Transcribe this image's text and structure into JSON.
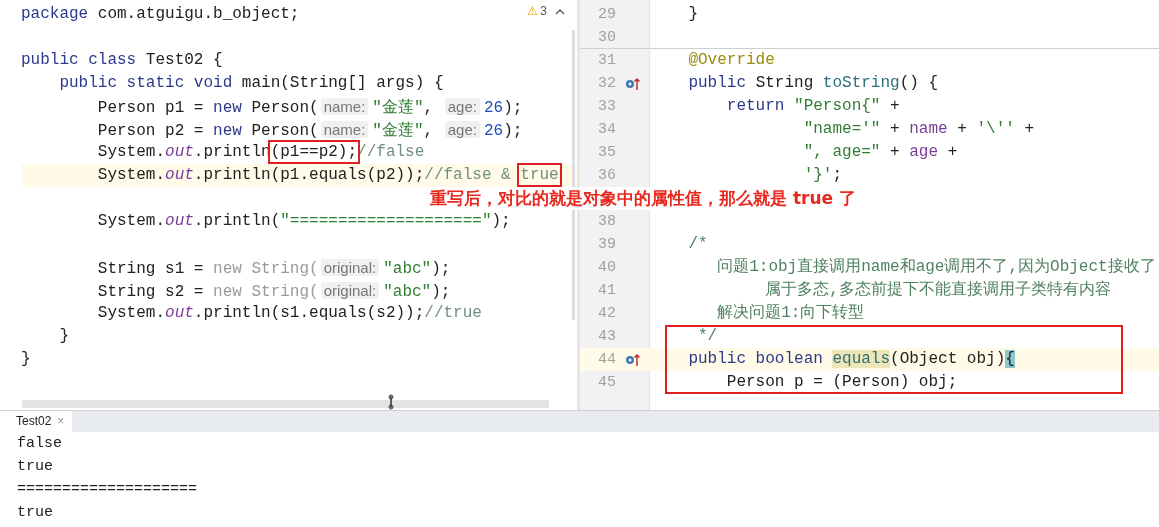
{
  "left_editor": {
    "warnings": {
      "icon_text": "⚠",
      "count": "3"
    },
    "lines": [
      {
        "tokens": [
          {
            "text": "package ",
            "kind": "kw"
          },
          {
            "text": "com.atguigu.b_object;",
            "kind": "plain"
          }
        ]
      },
      {
        "kind": "blank"
      },
      {
        "tokens": [
          {
            "text": "public class ",
            "kind": "kw"
          },
          {
            "text": "Test02 {",
            "kind": "plain"
          }
        ]
      },
      {
        "tokens": [
          {
            "text": "    public static void ",
            "kind": "kw"
          },
          {
            "text": "main(String[] args) {",
            "kind": "plain"
          }
        ]
      },
      {
        "tokens": [
          {
            "text": "        Person p1 = ",
            "kind": "plain"
          },
          {
            "text": "new ",
            "kind": "kw"
          },
          {
            "text": "Person(",
            "kind": "plain"
          },
          {
            "text": "name:",
            "kind": "hint"
          },
          {
            "text": "\"金莲\"",
            "kind": "str"
          },
          {
            "text": ", ",
            "kind": "plain"
          },
          {
            "text": "age:",
            "kind": "hint"
          },
          {
            "text": "26",
            "kind": "num"
          },
          {
            "text": ");",
            "kind": "plain"
          }
        ]
      },
      {
        "tokens": [
          {
            "text": "        Person p2 = ",
            "kind": "plain"
          },
          {
            "text": "new ",
            "kind": "kw"
          },
          {
            "text": "Person(",
            "kind": "plain"
          },
          {
            "text": "name:",
            "kind": "hint"
          },
          {
            "text": "\"金莲\"",
            "kind": "str"
          },
          {
            "text": ", ",
            "kind": "plain"
          },
          {
            "text": "age:",
            "kind": "hint"
          },
          {
            "text": "26",
            "kind": "num"
          },
          {
            "text": ");",
            "kind": "plain"
          }
        ]
      },
      {
        "tokens": [
          {
            "text": "        System.",
            "kind": "plain"
          },
          {
            "text": "out",
            "kind": "field"
          },
          {
            "text": ".println",
            "kind": "plain"
          },
          {
            "text": "(p1==p2);",
            "kind": "plain",
            "boxed": true
          },
          {
            "text": "//false",
            "kind": "comment"
          }
        ]
      },
      {
        "highlighted": true,
        "tokens": [
          {
            "text": "        System.",
            "kind": "plain"
          },
          {
            "text": "out",
            "kind": "field"
          },
          {
            "text": ".println(p1.equals(p2));",
            "kind": "plain"
          },
          {
            "text": "//false & ",
            "kind": "comment"
          },
          {
            "text": "true",
            "kind": "comment",
            "boxed": true
          }
        ]
      },
      {
        "kind": "blank"
      },
      {
        "tokens": [
          {
            "text": "        System.",
            "kind": "plain"
          },
          {
            "text": "out",
            "kind": "field"
          },
          {
            "text": ".println(",
            "kind": "plain"
          },
          {
            "text": "\"====================\"",
            "kind": "str"
          },
          {
            "text": ");",
            "kind": "plain"
          }
        ]
      },
      {
        "kind": "blank"
      },
      {
        "tokens": [
          {
            "text": "        String s1 = ",
            "kind": "plain"
          },
          {
            "text": "new String(",
            "kind": "faint"
          },
          {
            "text": "original:",
            "kind": "hint"
          },
          {
            "text": "\"abc\"",
            "kind": "str"
          },
          {
            "text": ");",
            "kind": "plain"
          }
        ]
      },
      {
        "tokens": [
          {
            "text": "        String s2 = ",
            "kind": "plain"
          },
          {
            "text": "new String(",
            "kind": "faint"
          },
          {
            "text": "original:",
            "kind": "hint"
          },
          {
            "text": "\"abc\"",
            "kind": "str"
          },
          {
            "text": ");",
            "kind": "plain"
          }
        ]
      },
      {
        "tokens": [
          {
            "text": "        System.",
            "kind": "plain"
          },
          {
            "text": "out",
            "kind": "field"
          },
          {
            "text": ".println(s1.equals(s2));",
            "kind": "plain"
          },
          {
            "text": "//true",
            "kind": "comment"
          }
        ]
      },
      {
        "tokens": [
          {
            "text": "    }",
            "kind": "plain"
          }
        ]
      },
      {
        "tokens": [
          {
            "text": "}",
            "kind": "plain"
          }
        ]
      }
    ]
  },
  "note": "重写后，对比的就是对象中的属性值，那么就是 true 了",
  "right_editor": {
    "blocks": [
      {
        "boxed": false,
        "lines": [
          {
            "number": "29",
            "tokens": [
              {
                "text": "    }",
                "kind": "plain"
              }
            ]
          },
          {
            "number": "30",
            "separator_after": true
          },
          {
            "number": "31",
            "tokens": [
              {
                "text": "    @Override",
                "kind": "annotation"
              }
            ]
          },
          {
            "number": "32",
            "marker": {
              "kind": "override"
            },
            "tokens": [
              {
                "text": "    public ",
                "kind": "kw"
              },
              {
                "text": "String ",
                "kind": "plain"
              },
              {
                "text": "toString",
                "kind": "method"
              },
              {
                "text": "() {",
                "kind": "plain"
              }
            ]
          },
          {
            "number": "33",
            "tokens": [
              {
                "text": "        return ",
                "kind": "kw"
              },
              {
                "text": "\"Person{\"",
                "kind": "str"
              },
              {
                "text": " +",
                "kind": "plain"
              }
            ]
          },
          {
            "number": "34",
            "tokens": [
              {
                "text": "                \"name='\"",
                "kind": "str"
              },
              {
                "text": " + ",
                "kind": "plain"
              },
              {
                "text": "name",
                "kind": "field2"
              },
              {
                "text": " + ",
                "kind": "plain"
              },
              {
                "text": "'\\''",
                "kind": "str"
              },
              {
                "text": " +",
                "kind": "plain"
              }
            ]
          },
          {
            "number": "35",
            "tokens": [
              {
                "text": "                \", age=\"",
                "kind": "str"
              },
              {
                "text": " + ",
                "kind": "plain"
              },
              {
                "text": "age",
                "kind": "field2"
              },
              {
                "text": " +",
                "kind": "plain"
              }
            ]
          },
          {
            "number": "36",
            "tokens": [
              {
                "text": "                '}'",
                "kind": "str"
              },
              {
                "text": ";",
                "kind": "plain"
              }
            ]
          },
          {
            "kind": "blank"
          },
          {
            "number": "38"
          },
          {
            "number": "39",
            "tokens": [
              {
                "text": "    /*",
                "kind": "doc"
              }
            ]
          },
          {
            "number": "40",
            "tokens": [
              {
                "text": "       问题1:obj直接调用name和age调用不了,因为Object接收了",
                "kind": "doc"
              }
            ]
          },
          {
            "number": "41",
            "tokens": [
              {
                "text": "            属于多态,多态前提下不能直接调用子类特有内容",
                "kind": "doc"
              }
            ]
          },
          {
            "number": "42",
            "tokens": [
              {
                "text": "       解决问题1:向下转型",
                "kind": "doc"
              }
            ]
          }
        ]
      },
      {
        "boxed": true,
        "lines": [
          {
            "number": "43",
            "tokens": [
              {
                "text": "     */",
                "kind": "doc"
              }
            ]
          },
          {
            "number": "44",
            "marker": {
              "kind": "override"
            },
            "highlighted": true,
            "tokens": [
              {
                "text": "    public boolean ",
                "kind": "kw"
              },
              {
                "text": "equals",
                "kind": "method_hl"
              },
              {
                "text": "(Object obj)",
                "kind": "plain"
              },
              {
                "text": "{",
                "kind": "brace_hl"
              }
            ]
          },
          {
            "number": "45",
            "tokens": [
              {
                "text": "        Person p = (Person) obj;",
                "kind": "plain"
              }
            ]
          }
        ]
      }
    ]
  },
  "console": {
    "tab": {
      "label": "Test02",
      "close": "×",
      "selected": true
    },
    "lines": [
      "false",
      "true",
      "====================",
      "true"
    ]
  }
}
